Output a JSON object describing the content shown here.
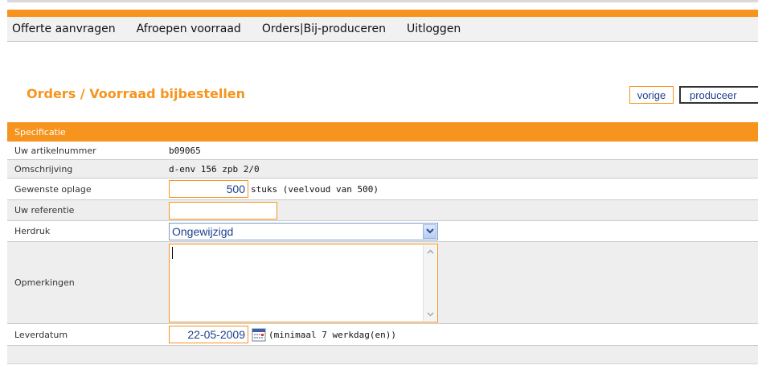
{
  "nav": {
    "items": [
      {
        "label": "Offerte aanvragen"
      },
      {
        "label": "Afroepen voorraad"
      },
      {
        "label": "Orders|Bij-produceren"
      },
      {
        "label": "Uitloggen"
      }
    ]
  },
  "page": {
    "title": "Orders / Voorraad bijbestellen",
    "buttons": {
      "back": "vorige",
      "produce": "produceer"
    }
  },
  "form": {
    "section_title": "Specificatie",
    "article": {
      "label": "Uw artikelnummer",
      "value": "b09065"
    },
    "description": {
      "label": "Omschrijving",
      "value": "d-env 156 zpb 2/0"
    },
    "quantity": {
      "label": "Gewenste oplage",
      "value": "500",
      "hint": "stuks (veelvoud van 500)"
    },
    "reference": {
      "label": "Uw referentie",
      "value": ""
    },
    "reprint": {
      "label": "Herdruk",
      "selected": "Ongewijzigd"
    },
    "remarks": {
      "label": "Opmerkingen",
      "value": ""
    },
    "delivery": {
      "label": "Leverdatum",
      "value": "22-05-2009",
      "hint": "(minimaal 7 werkdag(en))"
    }
  },
  "icons": {
    "dropdown": "chevron-down-icon",
    "calendar": "calendar-icon",
    "scroll_up": "scroll-up-icon",
    "scroll_down": "scroll-down-icon"
  },
  "colors": {
    "accent": "#f7941d",
    "link": "#1d3f8f",
    "row_alt": "#eeeeee"
  }
}
